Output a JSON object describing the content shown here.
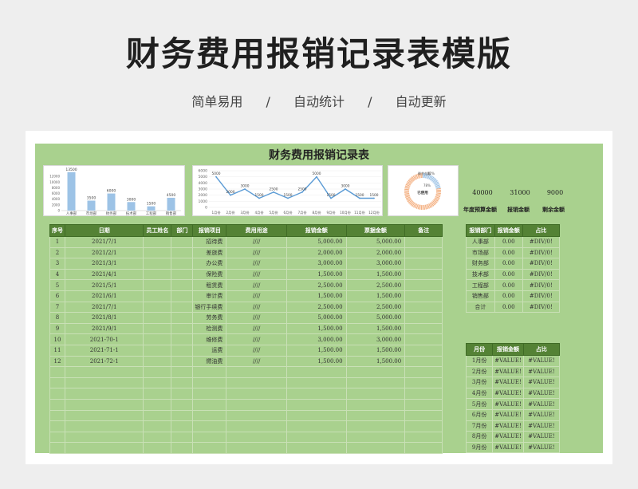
{
  "page": {
    "title": "财务费用报销记录表模版",
    "tags": [
      "简单易用",
      "自动统计",
      "自动更新"
    ],
    "separator": "/"
  },
  "sheet": {
    "title": "财务费用报销记录表",
    "stats": {
      "budget": "40000",
      "reimbursed": "31000",
      "remaining": "9000",
      "budget_label": "年度预算金额",
      "reimbursed_label": "报销金额",
      "remaining_label": "剩余金额"
    },
    "main_table": {
      "headers": [
        "序号",
        "日期",
        "员工姓名",
        "部门",
        "报销项目",
        "费用用途",
        "报销金额",
        "票据金额",
        "备注"
      ],
      "rows": [
        [
          "1",
          "2021/7/1",
          "",
          "",
          "招待费",
          "////",
          "5,000.00",
          "5,000.00",
          ""
        ],
        [
          "2",
          "2021/2/1",
          "",
          "",
          "差旅费",
          "////",
          "2,000.00",
          "2,000.00",
          ""
        ],
        [
          "3",
          "2021/3/1",
          "",
          "",
          "办公费",
          "////",
          "3,000.00",
          "3,000.00",
          ""
        ],
        [
          "4",
          "2021/4/1",
          "",
          "",
          "保险费",
          "////",
          "1,500.00",
          "1,500.00",
          ""
        ],
        [
          "5",
          "2021/5/1",
          "",
          "",
          "租赁费",
          "////",
          "2,500.00",
          "2,500.00",
          ""
        ],
        [
          "6",
          "2021/6/1",
          "",
          "",
          "审计费",
          "////",
          "1,500.00",
          "1,500.00",
          ""
        ],
        [
          "7",
          "2021/7/1",
          "",
          "",
          "银行手续费",
          "////",
          "2,500.00",
          "2,500.00",
          ""
        ],
        [
          "8",
          "2021/8/1",
          "",
          "",
          "劳务费",
          "////",
          "5,000.00",
          "5,000.00",
          ""
        ],
        [
          "9",
          "2021/9/1",
          "",
          "",
          "检测费",
          "////",
          "1,500.00",
          "1,500.00",
          ""
        ],
        [
          "10",
          "2021-70-1",
          "",
          "",
          "维修费",
          "////",
          "3,000.00",
          "3,000.00",
          ""
        ],
        [
          "11",
          "2021-71-1",
          "",
          "",
          "运费",
          "////",
          "1,500.00",
          "1,500.00",
          ""
        ],
        [
          "12",
          "2021-72-1",
          "",
          "",
          "燃油费",
          "////",
          "1,500.00",
          "1,500.00",
          ""
        ],
        [
          "",
          "",
          "",
          "",
          "",
          "",
          "",
          "",
          ""
        ],
        [
          "",
          "",
          "",
          "",
          "",
          "",
          "",
          "",
          ""
        ],
        [
          "",
          "",
          "",
          "",
          "",
          "",
          "",
          "",
          ""
        ],
        [
          "",
          "",
          "",
          "",
          "",
          "",
          "",
          "",
          ""
        ],
        [
          "",
          "",
          "",
          "",
          "",
          "",
          "",
          "",
          ""
        ],
        [
          "",
          "",
          "",
          "",
          "",
          "",
          "",
          "",
          ""
        ],
        [
          "",
          "",
          "",
          "",
          "",
          "",
          "",
          "",
          ""
        ],
        [
          "",
          "",
          "",
          "",
          "",
          "",
          "",
          "",
          ""
        ]
      ]
    },
    "dept_table": {
      "headers": [
        "报销部门",
        "报销金额",
        "占比"
      ],
      "rows": [
        [
          "人事部",
          "0.00",
          "#DIV/0!"
        ],
        [
          "市场部",
          "0.00",
          "#DIV/0!"
        ],
        [
          "财务部",
          "0.00",
          "#DIV/0!"
        ],
        [
          "技术部",
          "0.00",
          "#DIV/0!"
        ],
        [
          "工程部",
          "0.00",
          "#DIV/0!"
        ],
        [
          "销售部",
          "0.00",
          "#DIV/0!"
        ],
        [
          "合计",
          "0.00",
          "#DIV/0!"
        ]
      ]
    },
    "month_table": {
      "headers": [
        "月份",
        "报销金额",
        "占比"
      ],
      "rows": [
        [
          "1月份",
          "#VALUE!",
          "#VALUE!"
        ],
        [
          "2月份",
          "#VALUE!",
          "#VALUE!"
        ],
        [
          "3月份",
          "#VALUE!",
          "#VALUE!"
        ],
        [
          "4月份",
          "#VALUE!",
          "#VALUE!"
        ],
        [
          "5月份",
          "#VALUE!",
          "#VALUE!"
        ],
        [
          "6月份",
          "#VALUE!",
          "#VALUE!"
        ],
        [
          "7月份",
          "#VALUE!",
          "#VALUE!"
        ],
        [
          "8月份",
          "#VALUE!",
          "#VALUE!"
        ],
        [
          "9月份",
          "#VALUE!",
          "#VALUE!"
        ]
      ]
    }
  },
  "chart_data": [
    {
      "type": "bar",
      "categories": [
        "人事部",
        "市场部",
        "财务部",
        "技术部",
        "工程部",
        "销售部"
      ],
      "values": [
        13500,
        3500,
        6000,
        3000,
        1500,
        4500
      ],
      "yticks": [
        0,
        2000,
        4000,
        6000,
        8000,
        10000,
        12000
      ],
      "ylim": [
        0,
        14000
      ],
      "color": "#9dc3e6"
    },
    {
      "type": "line",
      "categories": [
        "1月份",
        "2月份",
        "3月份",
        "4月份",
        "5月份",
        "6月份",
        "7月份",
        "8月份",
        "9月份",
        "10月份",
        "11月份",
        "12月份"
      ],
      "values": [
        5000,
        2000,
        3000,
        1500,
        2500,
        1500,
        2500,
        5000,
        1500,
        3000,
        1500,
        1500
      ],
      "yticks": [
        0,
        1000,
        2000,
        3000,
        4000,
        5000,
        6000
      ],
      "ylim": [
        0,
        6000
      ],
      "color": "#5b9bd5"
    },
    {
      "type": "pie",
      "labels": [
        "剩余金额",
        "已使用"
      ],
      "values": [
        22,
        78
      ],
      "display": [
        "22%",
        "78%"
      ],
      "center_label": "已使用",
      "colors": [
        "#9dc3e6",
        "#f4b183"
      ]
    }
  ]
}
